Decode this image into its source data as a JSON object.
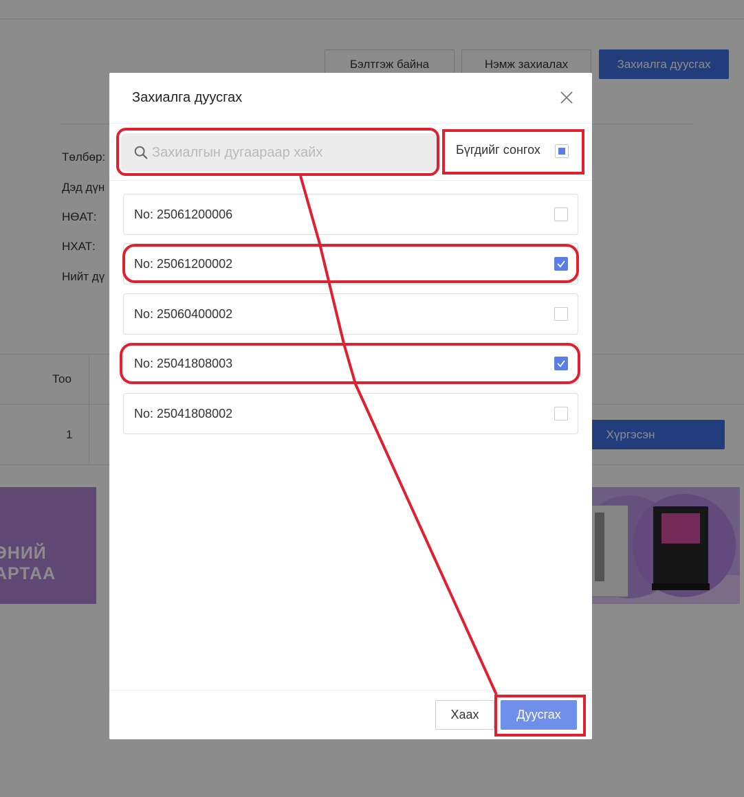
{
  "header_buttons": {
    "preparing": "Бэлтгэж байна",
    "add_order": "Нэмж захиалах",
    "finish_order": "Захиалга дуусгах"
  },
  "info_labels": [
    "Төлбөр:",
    "Дэд дүн",
    "НӨАТ:",
    "НХАТ:",
    "Нийт дү"
  ],
  "table": {
    "header_qty": "Тоо",
    "row_qty": "1",
    "delivered_button": "Хүргэсэн"
  },
  "banner": {
    "line1": "ЭНИЙ",
    "line2": "АРТАА"
  },
  "modal": {
    "title": "Захиалга дуусгах",
    "close_icon": "close-icon",
    "search_placeholder": "Захиалгын дугаараар хайх",
    "search_value": "",
    "select_all_label": "Бүгдийг сонгох",
    "select_all_state": "indeterminate",
    "orders": [
      {
        "label": "No: 25061200006",
        "checked": false
      },
      {
        "label": "No: 25061200002",
        "checked": true
      },
      {
        "label": "No: 25060400002",
        "checked": false
      },
      {
        "label": "No: 25041808003",
        "checked": true
      },
      {
        "label": "No: 25041808002",
        "checked": false
      }
    ],
    "close_button": "Хаах",
    "finish_button": "Дуусгах"
  },
  "colors": {
    "primary": "#3d6fe0",
    "checkbox": "#5b7ee6",
    "annotation": "#e0202e"
  }
}
